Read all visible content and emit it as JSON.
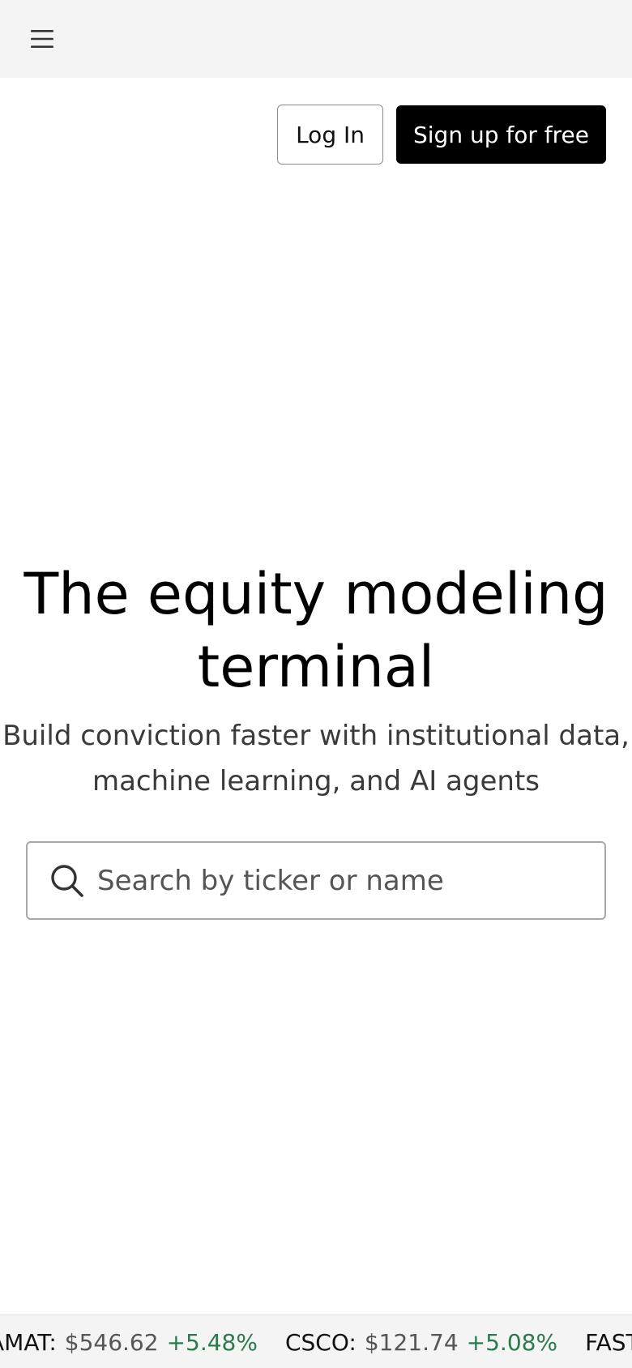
{
  "header": {
    "menu_icon": "hamburger-menu-icon"
  },
  "auth": {
    "login_label": "Log In",
    "signup_label": "Sign up for free"
  },
  "hero": {
    "title": "The equity modeling terminal",
    "subtitle": "Build conviction faster with institutional data, machine learning, and AI agents"
  },
  "search": {
    "icon": "search-icon",
    "placeholder": "Search by ticker or name"
  },
  "ticker": {
    "items": [
      {
        "symbol": "AMAT:",
        "price": "$546.62",
        "change": "+5.48%"
      },
      {
        "symbol": "CSCO:",
        "price": "$121.74",
        "change": "+5.08%"
      },
      {
        "symbol": "FAST:",
        "price": "$",
        "change": ""
      }
    ]
  },
  "colors": {
    "topbar_bg": "#f4f4f4",
    "primary_button_bg": "#000000",
    "positive_change": "#2c7a4b"
  }
}
